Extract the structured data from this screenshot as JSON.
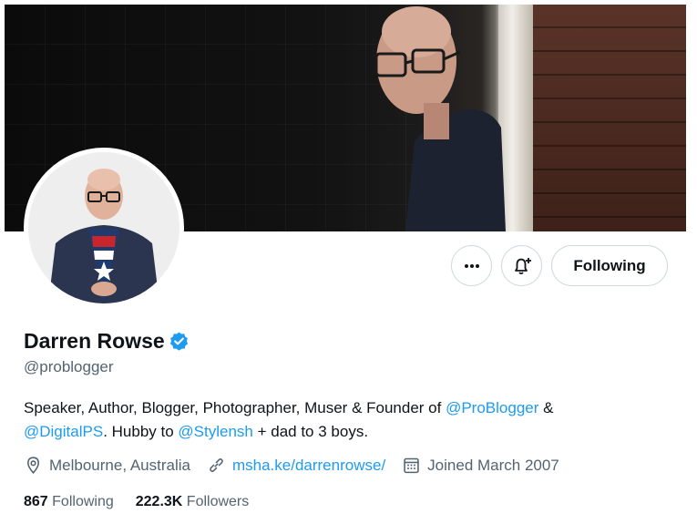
{
  "profile": {
    "name": "Darren Rowse",
    "handle": "@problogger",
    "bio": {
      "part1": "Speaker, Author, Blogger, Photographer, Muser & Founder of ",
      "mention1": "@ProBlogger",
      "part2": " & ",
      "mention2": "@DigitalPS",
      "part3": ". Hubby to ",
      "mention3": "@Stylensh",
      "part4": " + dad to 3 boys."
    },
    "location": "Melbourne, Australia",
    "website": "msha.ke/darrenrowse/",
    "joined": "Joined March 2007",
    "following_count": "867",
    "following_label": "Following",
    "followers_count": "222.3K",
    "followers_label": "Followers"
  },
  "actions": {
    "more_icon": "more-icon",
    "bell_icon": "notification-bell-plus-icon",
    "follow_label": "Following"
  },
  "icons": {
    "verified": "verified-badge-icon",
    "location": "location-pin-icon",
    "link": "link-icon",
    "calendar": "calendar-icon"
  },
  "colors": {
    "accent": "#1d9bf0",
    "text": "#0f1419",
    "muted": "#536471",
    "border": "#cfd9de"
  }
}
